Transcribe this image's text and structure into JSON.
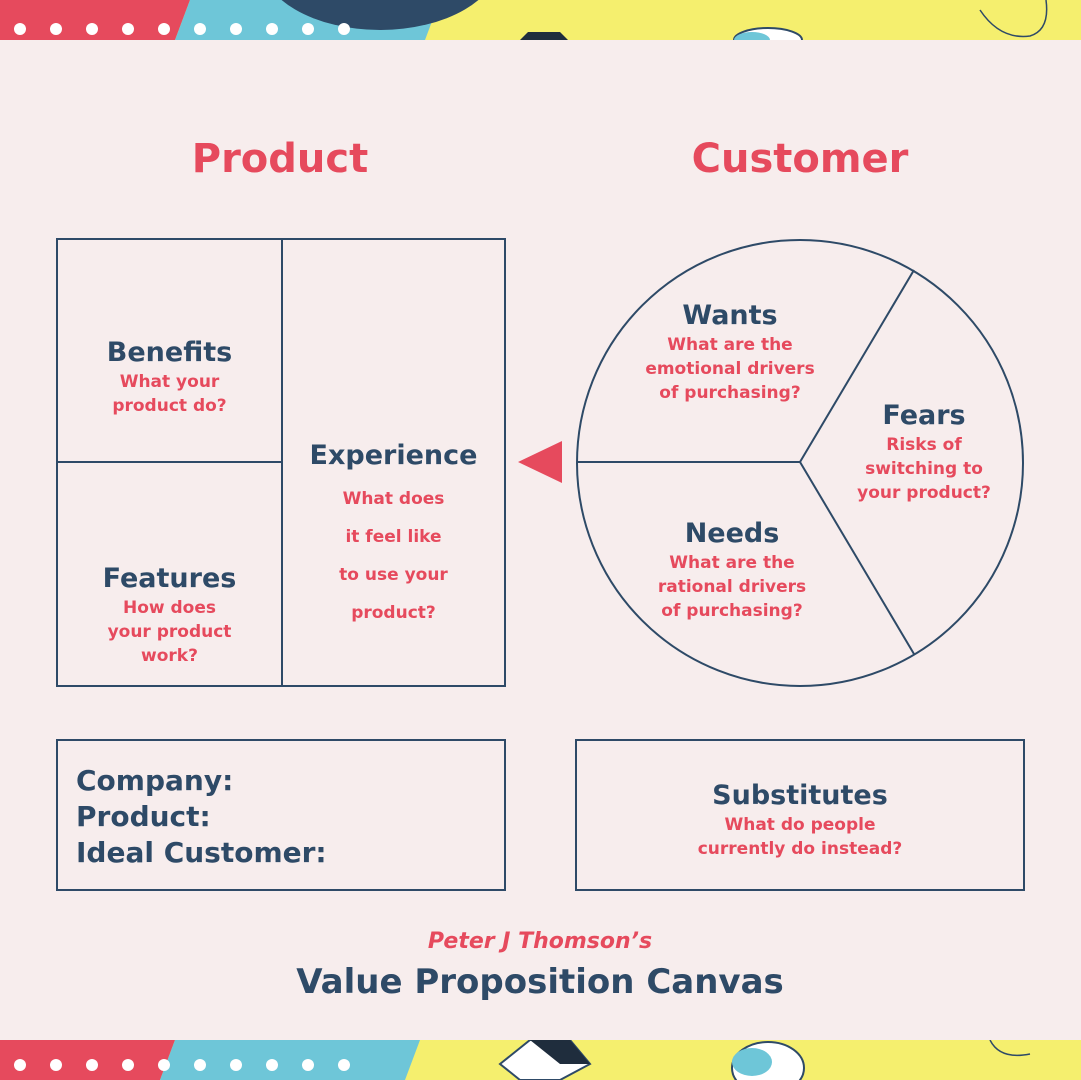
{
  "product": {
    "heading": "Product",
    "benefits": {
      "title": "Benefits",
      "question_lines": [
        "What your",
        "product do?"
      ]
    },
    "features": {
      "title": "Features",
      "question_lines": [
        "How does",
        "your product",
        "work?"
      ]
    },
    "experience": {
      "title": "Experience",
      "question_lines": [
        "What does",
        "it feel like",
        "to use your",
        "product?"
      ]
    }
  },
  "customer": {
    "heading": "Customer",
    "wants": {
      "title": "Wants",
      "question_lines": [
        "What are the",
        "emotional drivers",
        "of purchasing?"
      ]
    },
    "fears": {
      "title": "Fears",
      "question_lines": [
        "Risks of",
        "switching to",
        "your product?"
      ]
    },
    "needs": {
      "title": "Needs",
      "question_lines": [
        "What are the",
        "rational drivers",
        "of purchasing?"
      ]
    }
  },
  "details": {
    "company": "Company:",
    "product": "Product:",
    "ideal_customer": "Ideal Customer:"
  },
  "substitutes": {
    "title": "Substitutes",
    "question_lines": [
      "What do people",
      "currently do instead?"
    ]
  },
  "footer": {
    "author": "Peter J Thomson’s",
    "title": "Value Proposition Canvas"
  },
  "colors": {
    "accent_red": "#e64a5d",
    "navy": "#2e4a67",
    "background": "#f7eded",
    "band_yellow": "#f5ef6e",
    "band_cyan": "#6ec6d8"
  }
}
